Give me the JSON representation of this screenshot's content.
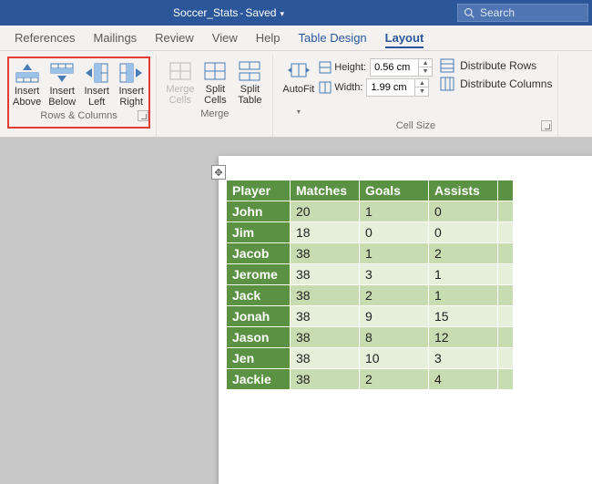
{
  "title": {
    "doc": "Soccer_Stats",
    "status": "Saved"
  },
  "search": {
    "placeholder": "Search"
  },
  "tabs": {
    "references": "References",
    "mailings": "Mailings",
    "review": "Review",
    "view": "View",
    "help": "Help",
    "table_design": "Table Design",
    "layout": "Layout"
  },
  "ribbon": {
    "rows_cols": {
      "label": "Rows & Columns",
      "insert_above": "Insert\nAbove",
      "insert_below": "Insert\nBelow",
      "insert_left": "Insert\nLeft",
      "insert_right": "Insert\nRight"
    },
    "merge": {
      "label": "Merge",
      "merge_cells": "Merge\nCells",
      "split_cells": "Split\nCells",
      "split_table": "Split\nTable"
    },
    "cell_size": {
      "label": "Cell Size",
      "autofit": "AutoFit",
      "height_label": "Height:",
      "width_label": "Width:",
      "height_value": "0.56 cm",
      "width_value": "1.99 cm",
      "dist_rows": "Distribute Rows",
      "dist_cols": "Distribute Columns"
    }
  },
  "table": {
    "headers": [
      "Player",
      "Matches",
      "Goals",
      "Assists"
    ],
    "rows": [
      {
        "name": "John",
        "matches": "20",
        "goals": "1",
        "assists": "0"
      },
      {
        "name": "Jim",
        "matches": "18",
        "goals": "0",
        "assists": "0"
      },
      {
        "name": "Jacob",
        "matches": "38",
        "goals": "1",
        "assists": "2"
      },
      {
        "name": "Jerome",
        "matches": "38",
        "goals": "3",
        "assists": "1"
      },
      {
        "name": "Jack",
        "matches": "38",
        "goals": "2",
        "assists": "1"
      },
      {
        "name": "Jonah",
        "matches": "38",
        "goals": "9",
        "assists": "15"
      },
      {
        "name": "Jason",
        "matches": "38",
        "goals": "8",
        "assists": "12"
      },
      {
        "name": "Jen",
        "matches": "38",
        "goals": "10",
        "assists": "3"
      },
      {
        "name": "Jackie",
        "matches": "38",
        "goals": "2",
        "assists": "4"
      }
    ]
  }
}
